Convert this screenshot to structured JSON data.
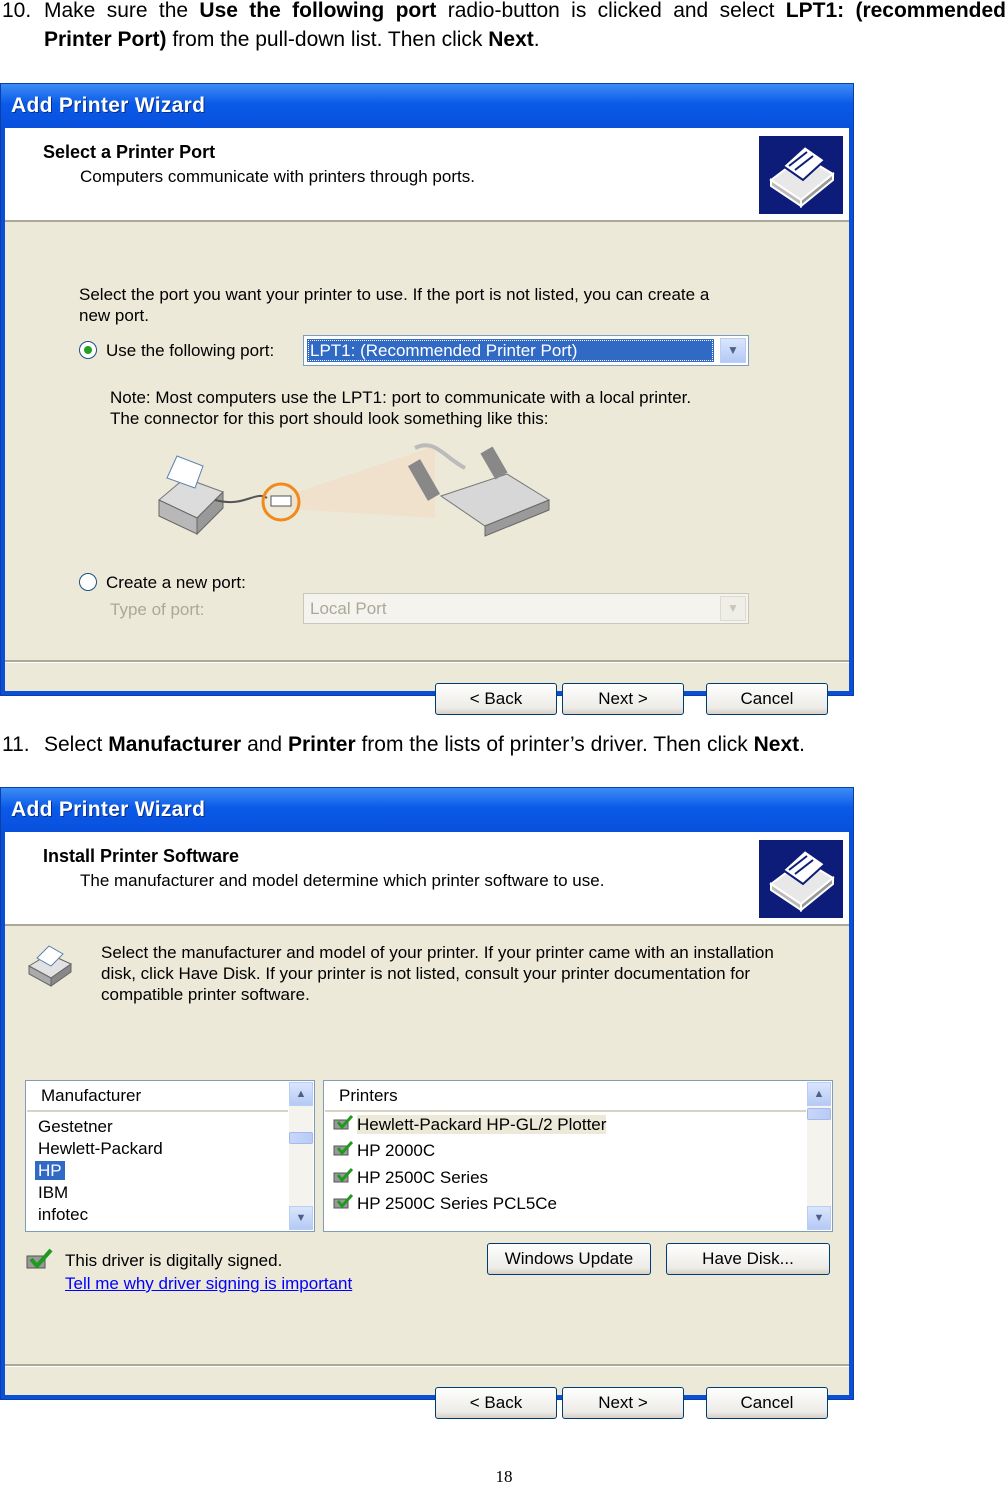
{
  "step10": {
    "number": "10.",
    "t1": "Make sure the ",
    "b1": "Use the following port",
    "t2": " radio-button is clicked and select ",
    "b2": "LPT1: (recommended Printer Port)",
    "t3": " from the pull-down list. Then click ",
    "b3": "Next",
    "t4": "."
  },
  "step11": {
    "number": "11.",
    "t1": "Select ",
    "b1": "Manufacturer",
    "t2": " and ",
    "b2": "Printer",
    "t3": " from the lists of printer’s driver. Then click ",
    "b3": "Next",
    "t4": "."
  },
  "wizard1": {
    "title": "Add Printer Wizard",
    "header_title": "Select a Printer Port",
    "header_subtitle": "Computers communicate with printers through ports.",
    "intro_line1": "Select the port you want your printer to use.  If the port is not listed, you can create a",
    "intro_line2": "new port.",
    "use_port_label": "Use the following port:",
    "use_port_value": "LPT1: (Recommended Printer Port)",
    "note_line1": "Note: Most computers use the LPT1: port to communicate with a local printer.",
    "note_line2": "The connector for this port should look something like this:",
    "create_port_label": "Create a new port:",
    "type_of_port_label": "Type of port:",
    "type_of_port_value": "Local Port",
    "back_label": "< Back",
    "next_label": "Next >",
    "cancel_label": "Cancel"
  },
  "wizard2": {
    "title": "Add Printer Wizard",
    "header_title": "Install Printer Software",
    "header_subtitle": "The manufacturer and model determine which printer software to use.",
    "intro_line1": "Select the manufacturer and model of your printer. If your printer came with an installation",
    "intro_line2": "disk, click Have Disk. If your printer is not listed, consult your printer documentation for",
    "intro_line3": "compatible printer software.",
    "manufacturer_header": "Manufacturer",
    "manufacturers": [
      "Gestetner",
      "Hewlett-Packard",
      "HP",
      "IBM",
      "infotec"
    ],
    "printers_header": "Printers",
    "printers": [
      "Hewlett-Packard HP-GL/2 Plotter",
      "HP 2000C",
      "HP 2500C Series",
      "HP 2500C Series PCL5Ce"
    ],
    "signed_text": "This driver is digitally signed.",
    "signing_link": "Tell me why driver signing is important",
    "windows_update_label": "Windows Update",
    "have_disk_label": "Have Disk...",
    "back_label": "< Back",
    "next_label": "Next >",
    "cancel_label": "Cancel"
  },
  "page_number": "18",
  "colors": {
    "titlebar": "#0a5ae8",
    "dialog_bg": "#ece9d8",
    "selection": "#316ac5",
    "link": "#0000ff"
  }
}
